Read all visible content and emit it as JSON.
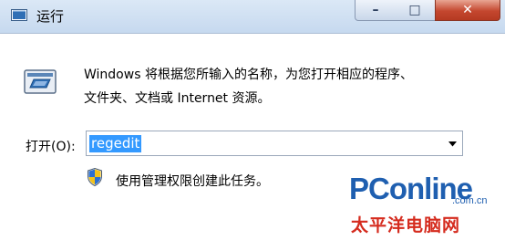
{
  "window": {
    "title": "运行",
    "minimize_glyph": "–",
    "maximize_glyph": "□",
    "close_glyph": "✕"
  },
  "dialog": {
    "description_line1": "Windows 将根据您所输入的名称，为您打开相应的程序、",
    "description_line2": "文件夹、文档或 Internet 资源。",
    "open_label": "打开(O):",
    "open_value": "regedit",
    "admin_note": "使用管理权限创建此任务。"
  },
  "watermark": {
    "brand_pc": "PC",
    "brand_online": "online",
    "domain": ".com.cn",
    "chinese_name": "太平洋电脑网"
  },
  "colors": {
    "selection": "#3399ff",
    "brand_blue": "#1f5fb0",
    "brand_red": "#d52b1e"
  },
  "icons": [
    "run-app-icon",
    "run-program-icon",
    "dropdown-arrow-icon",
    "uac-shield-icon"
  ]
}
